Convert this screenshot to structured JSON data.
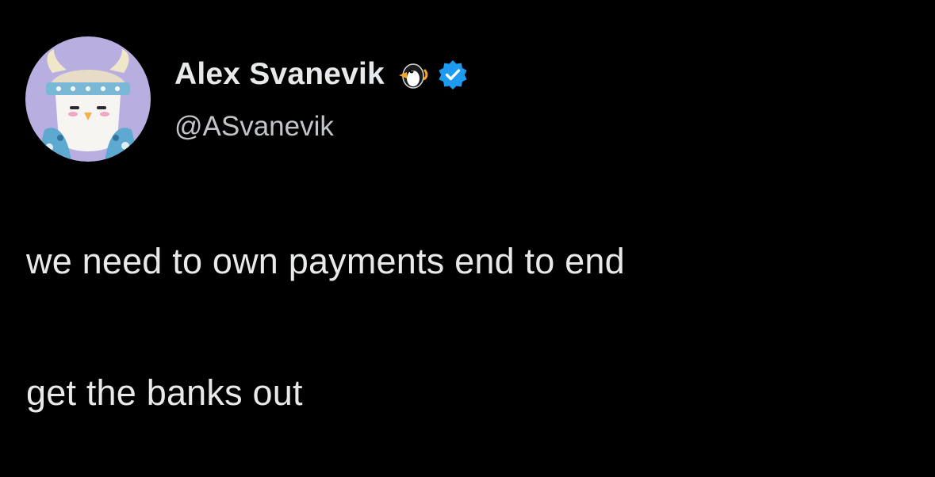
{
  "author": {
    "display_name": "Alex Svanevik",
    "handle": "@ASvanevik",
    "name_emoji": "penguin-icon",
    "badge": "verified-badge-icon",
    "badge_color": "#1d9bf0"
  },
  "tweet": {
    "lines": [
      "we need to own payments end to end",
      "get the banks out"
    ]
  },
  "colors": {
    "background": "#000000",
    "primary_text": "#e7e9ea",
    "secondary_text": "#c2c5c8",
    "avatar_bg": "#b9aee0"
  }
}
